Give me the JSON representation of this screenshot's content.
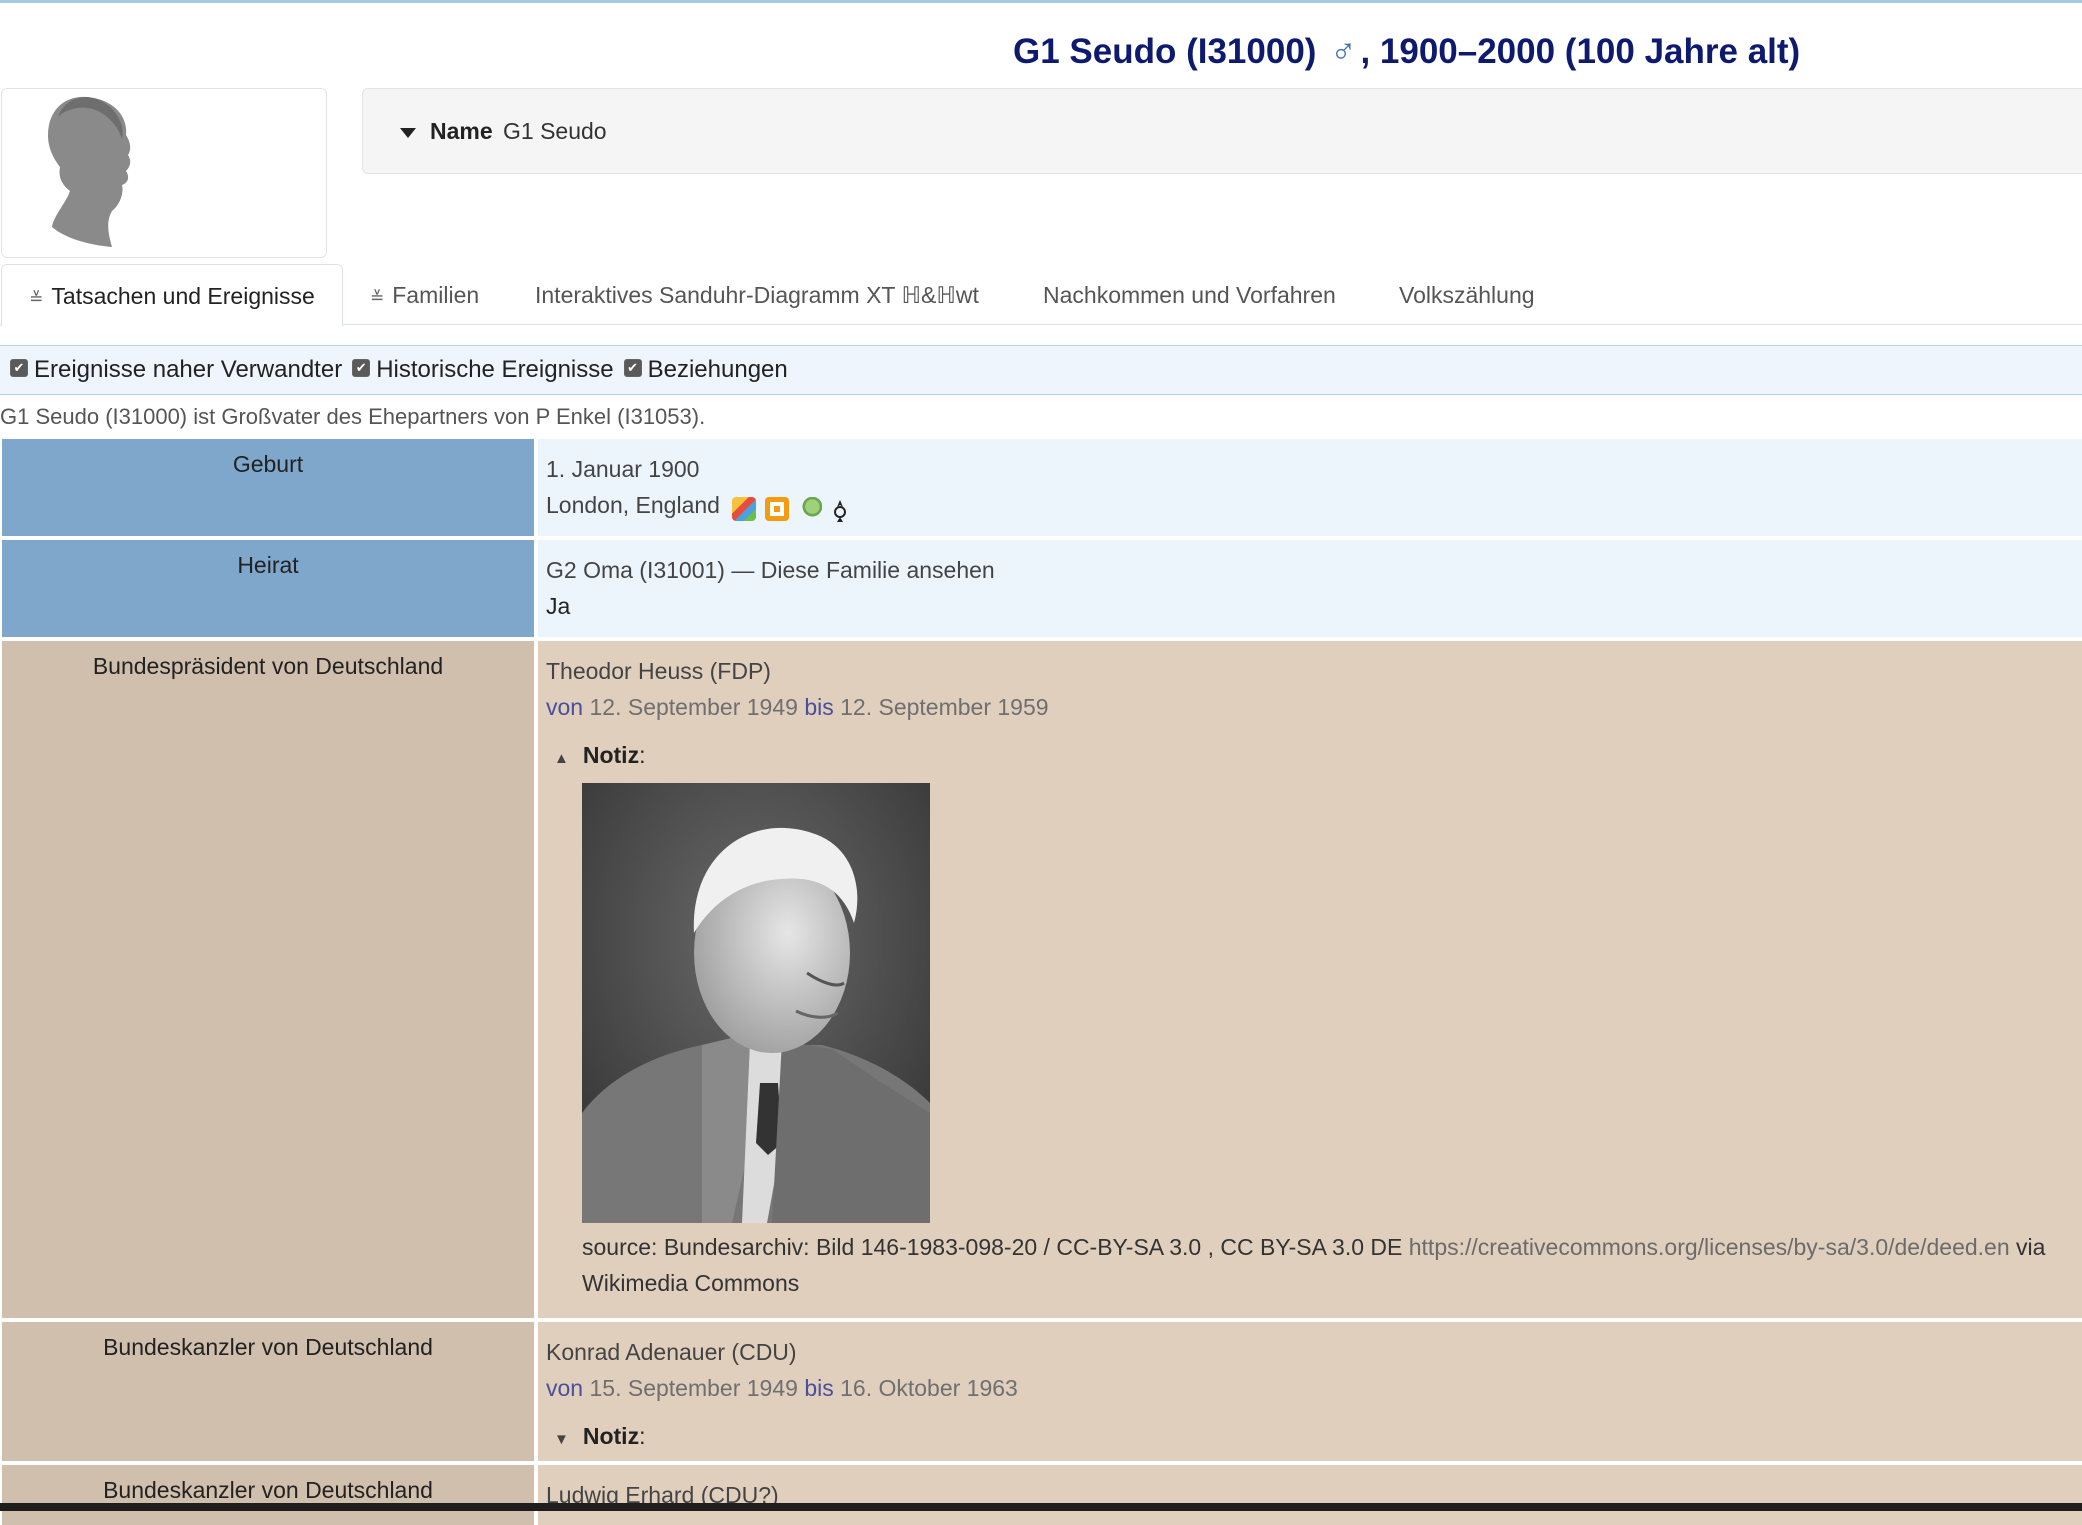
{
  "header": {
    "name_id": "G1 Seudo (I31000)",
    "sex_symbol": "♂",
    "lifespan": ", 1900–2000 (100 Jahre alt)"
  },
  "name_panel": {
    "label": "Name",
    "value": "G1 Seudo"
  },
  "tabs": [
    {
      "label": "Tatsachen und Ereignisse",
      "icon": "collapse-icon",
      "active": true
    },
    {
      "label": "Familien",
      "icon": "collapse-icon",
      "active": false
    },
    {
      "label": "Interaktives Sanduhr-Diagramm XT ℍ&ℍwt",
      "active": false
    },
    {
      "label": "Nachkommen und Vorfahren",
      "active": false
    },
    {
      "label": "Volkszählung",
      "active": false
    }
  ],
  "filters": [
    {
      "label": "Ereignisse naher Verwandter",
      "checked": true
    },
    {
      "label": "Historische Ereignisse",
      "checked": true
    },
    {
      "label": "Beziehungen",
      "checked": true
    }
  ],
  "relationship_text": "G1 Seudo (I31000) ist Großvater des Ehepartners von P Enkel (I31053).",
  "facts": [
    {
      "label": "Geburt",
      "date": "1. Januar 1900",
      "place": "London, England"
    },
    {
      "label": "Heirat",
      "spouse": "G2 Oma (I31001) — Diese Familie ansehen",
      "value": "Ja"
    },
    {
      "label": "Bundespräsident von Deutschland",
      "person": "Theodor Heuss (FDP)",
      "from_kw": "von",
      "from": "12. September 1949",
      "to_kw": "bis",
      "to": "12. September 1959",
      "note_label": "Notiz",
      "source_text": "source: Bundesarchiv: Bild 146-1983-098-20 / CC-BY-SA 3.0 , CC BY-SA 3.0 DE ",
      "source_link": "https://creativecommons.org/licenses/by-sa/3.0/de/deed.en",
      "source_via": " via Wikimedia Commons"
    },
    {
      "label": "Bundeskanzler von Deutschland",
      "person": "Konrad Adenauer (CDU)",
      "from_kw": "von",
      "from": "15. September 1949",
      "to_kw": "bis",
      "to": "16. Oktober 1963",
      "note_label": "Notiz"
    },
    {
      "label": "Bundeskanzler von Deutschland",
      "person": "Ludwig Erhard (CDU?)"
    }
  ],
  "colors": {
    "title": "#0e1a6e",
    "personal_label_bg": "#7fa7cc",
    "personal_value_bg": "#edf5fc",
    "historic_label_bg": "#d0bfac",
    "historic_value_bg": "#e1cfbe"
  }
}
